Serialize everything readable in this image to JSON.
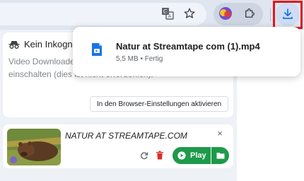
{
  "incognito": {
    "title": "Kein Inkognito",
    "body": "Video Downloader ist im Inkognito-Fenster aktiviert. D… einschalten (dies ist nicht erforderlich).",
    "settings_button": "In den Browser-Einstellungen aktivieren"
  },
  "video": {
    "title": "NATUR AT STREAMTAPE.COM",
    "close": "×",
    "play_label": "Play"
  },
  "download_bubble": {
    "file_name": "Natur at Streamtape com (1).mp4",
    "size": "5,5 MB",
    "separator": "•",
    "status": "Fertig"
  },
  "colors": {
    "accent_blue": "#1a73e8",
    "play_green": "#1e9a4a",
    "highlight_red": "#e3151a",
    "trash_red": "#d93025"
  },
  "icons": [
    "translate-icon",
    "star-icon",
    "extension-icon",
    "puzzle-icon",
    "download-icon",
    "incognito-icon",
    "refresh-icon",
    "trash-icon",
    "play-icon",
    "folder-icon",
    "file-icon"
  ]
}
